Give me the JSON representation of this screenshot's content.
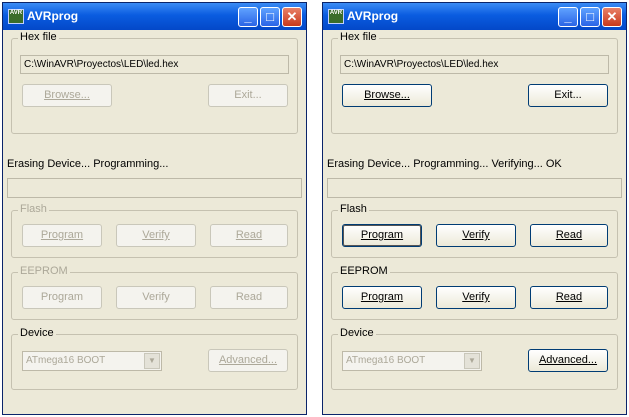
{
  "windows": [
    {
      "title": "AVRprog",
      "app_icon_text": "AVR",
      "hex_file": {
        "legend": "Hex file",
        "path": "C:\\WinAVR\\Proyectos\\LED\\led.hex",
        "browse_label": "Browse...",
        "exit_label": "Exit..."
      },
      "status": "Erasing Device... Programming...",
      "flash": {
        "legend": "Flash",
        "program": "Program",
        "verify": "Verify",
        "read": "Read"
      },
      "eeprom": {
        "legend": "EEPROM",
        "program": "Program",
        "verify": "Verify",
        "read": "Read"
      },
      "device": {
        "legend": "Device",
        "selected": "ATmega16 BOOT",
        "advanced_label": "Advanced..."
      }
    },
    {
      "title": "AVRprog",
      "app_icon_text": "AVR",
      "hex_file": {
        "legend": "Hex file",
        "path": "C:\\WinAVR\\Proyectos\\LED\\led.hex",
        "browse_label": "Browse...",
        "exit_label": "Exit..."
      },
      "status": "Erasing Device... Programming... Verifying... OK",
      "flash": {
        "legend": "Flash",
        "program": "Program",
        "verify": "Verify",
        "read": "Read"
      },
      "eeprom": {
        "legend": "EEPROM",
        "program": "Program",
        "verify": "Verify",
        "read": "Read"
      },
      "device": {
        "legend": "Device",
        "selected": "ATmega16 BOOT",
        "advanced_label": "Advanced..."
      }
    }
  ],
  "icons": {
    "minimize": "minimize-icon",
    "maximize": "maximize-icon",
    "close": "close-icon",
    "dropdown": "chevron-down-icon"
  },
  "colors": {
    "titlebar": "#0a5ce0",
    "window_bg": "#ece9d8",
    "close_button": "#c8391c"
  }
}
